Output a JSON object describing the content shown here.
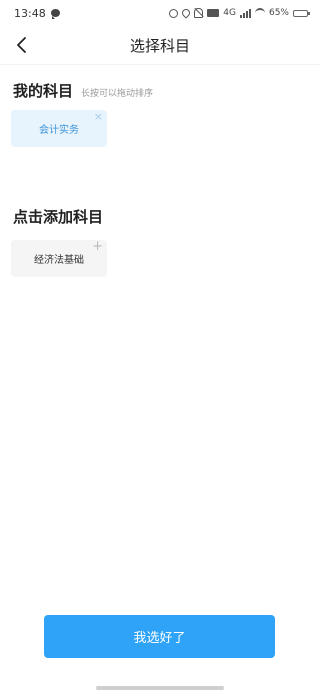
{
  "status_bar": {
    "time": "13:48",
    "network": "4G",
    "battery": "65%"
  },
  "header": {
    "title": "选择科目"
  },
  "my_subjects": {
    "title": "我的科目",
    "hint": "长按可以拖动排序",
    "items": [
      {
        "label": "会计实务",
        "action_symbol": "×"
      }
    ]
  },
  "add_subjects": {
    "title": "点击添加科目",
    "items": [
      {
        "label": "经济法基础",
        "action_symbol": "+"
      }
    ]
  },
  "footer": {
    "confirm_label": "我选好了"
  },
  "colors": {
    "accent": "#2ea3f7",
    "selected_chip_bg": "#e7f3fd",
    "selected_chip_text": "#3a93d9",
    "available_chip_bg": "#f5f5f5"
  }
}
